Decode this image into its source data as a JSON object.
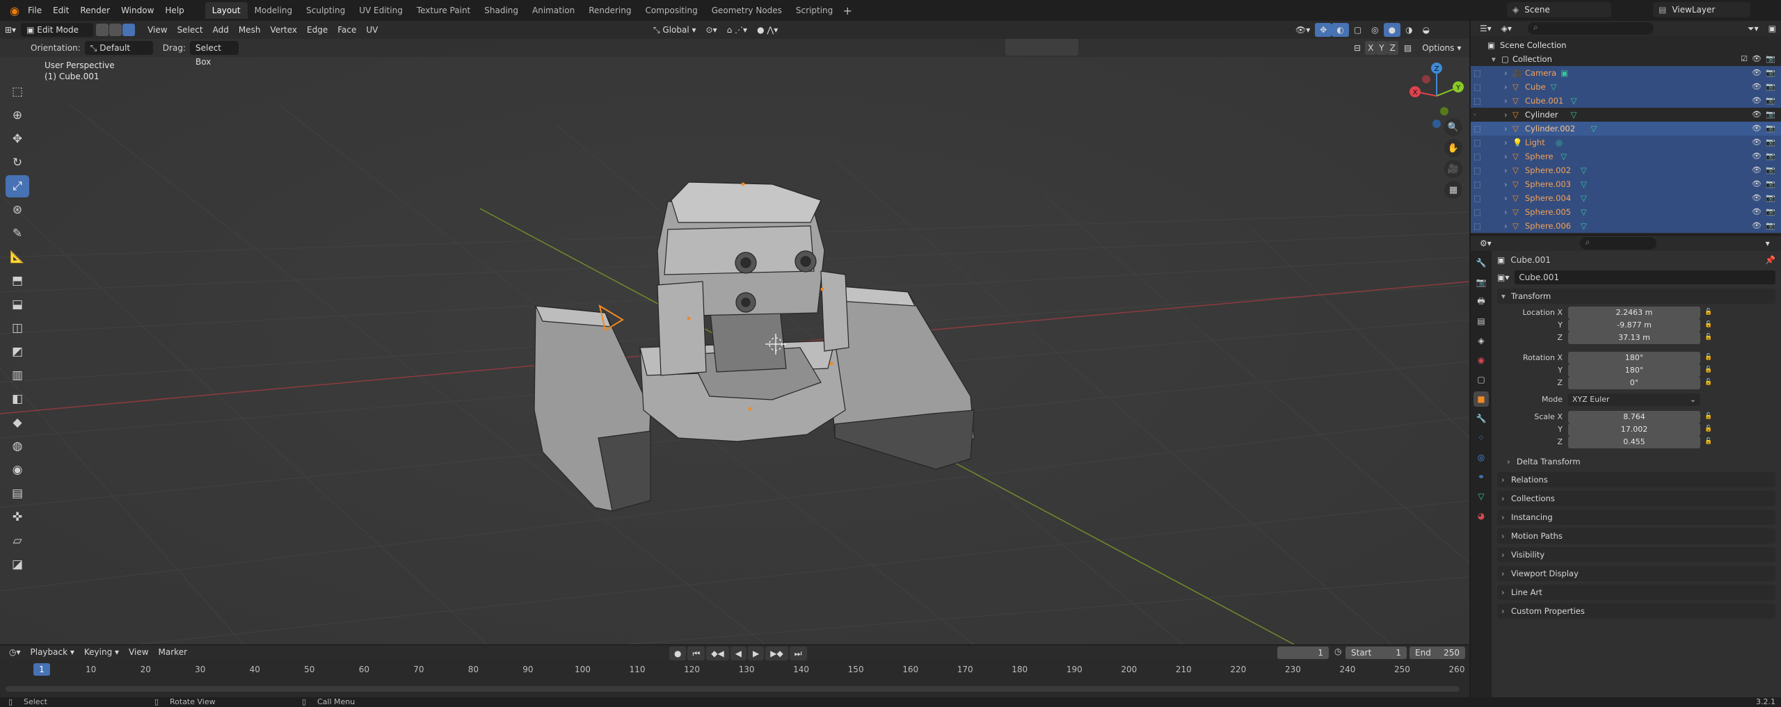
{
  "topbar": {
    "menus": [
      "File",
      "Edit",
      "Render",
      "Window",
      "Help"
    ],
    "workspaces": [
      "Layout",
      "Modeling",
      "Sculpting",
      "UV Editing",
      "Texture Paint",
      "Shading",
      "Animation",
      "Rendering",
      "Compositing",
      "Geometry Nodes",
      "Scripting"
    ],
    "active_workspace": "Layout",
    "scene": "Scene",
    "view_layer": "ViewLayer"
  },
  "viewport": {
    "mode": "Edit Mode",
    "header_menus": [
      "View",
      "Select",
      "Add",
      "Mesh",
      "Vertex",
      "Edge",
      "Face",
      "UV"
    ],
    "transform_orientation": "Global",
    "orientation_label": "Orientation:",
    "orientation_value": "Default",
    "drag_label": "Drag:",
    "drag_value": "Select Box",
    "axis_x": "X",
    "axis_y": "Y",
    "axis_z": "Z",
    "options_label": "Options",
    "view_name": "User Perspective",
    "object_label": "(1) Cube.001",
    "gizmo": {
      "x": "X",
      "y": "Y",
      "z": "Z"
    }
  },
  "toolbar": {
    "tools": [
      "select-box",
      "cursor",
      "move",
      "rotate",
      "scale",
      "transform",
      "annotate",
      "measure",
      "add-cube",
      "extrude",
      "inset",
      "bevel",
      "loop-cut",
      "knife",
      "poly-build",
      "spin",
      "smooth",
      "edge-slide",
      "shrink-fatten",
      "shear",
      "rip"
    ]
  },
  "timeline": {
    "menus": [
      "Playback",
      "Keying",
      "View",
      "Marker"
    ],
    "current_frame": "1",
    "start_label": "Start",
    "start": "1",
    "end_label": "End",
    "end": "250",
    "ruler": [
      "1",
      "10",
      "20",
      "30",
      "40",
      "50",
      "60",
      "70",
      "80",
      "90",
      "100",
      "110",
      "120",
      "130",
      "140",
      "150",
      "160",
      "170",
      "180",
      "190",
      "200",
      "210",
      "220",
      "230",
      "240",
      "250",
      "260"
    ]
  },
  "status": {
    "select": "Select",
    "rotate": "Rotate View",
    "menu": "Call Menu",
    "version": "3.2.1"
  },
  "outliner": {
    "scene_collection": "Scene Collection",
    "collection": "Collection",
    "items": [
      {
        "name": "Camera",
        "type": "camera",
        "selected": true,
        "active": false
      },
      {
        "name": "Cube",
        "type": "mesh",
        "selected": true,
        "active": false
      },
      {
        "name": "Cube.001",
        "type": "mesh",
        "selected": true,
        "active": false
      },
      {
        "name": "Cylinder",
        "type": "mesh",
        "selected": false,
        "active": false
      },
      {
        "name": "Cylinder.002",
        "type": "mesh",
        "selected": true,
        "active": true
      },
      {
        "name": "Light",
        "type": "light",
        "selected": true,
        "active": false
      },
      {
        "name": "Sphere",
        "type": "mesh",
        "selected": true,
        "active": false
      },
      {
        "name": "Sphere.002",
        "type": "mesh",
        "selected": true,
        "active": false
      },
      {
        "name": "Sphere.003",
        "type": "mesh",
        "selected": true,
        "active": false
      },
      {
        "name": "Sphere.004",
        "type": "mesh",
        "selected": true,
        "active": false
      },
      {
        "name": "Sphere.005",
        "type": "mesh",
        "selected": true,
        "active": false
      },
      {
        "name": "Sphere.006",
        "type": "mesh",
        "selected": true,
        "active": false
      }
    ]
  },
  "properties": {
    "object_name": "Cube.001",
    "data_name": "Cube.001",
    "transform_title": "Transform",
    "location_label": "Location X",
    "rotation_label": "Rotation X",
    "scale_label": "Scale X",
    "y_label": "Y",
    "z_label": "Z",
    "location": [
      "2.2463 m",
      "-9.877 m",
      "37.13 m"
    ],
    "rotation": [
      "180°",
      "180°",
      "0°"
    ],
    "mode_label": "Mode",
    "mode": "XYZ Euler",
    "scale": [
      "8.764",
      "17.002",
      "0.455"
    ],
    "delta": "Delta Transform",
    "panels": [
      "Relations",
      "Collections",
      "Instancing",
      "Motion Paths",
      "Visibility",
      "Viewport Display",
      "Line Art",
      "Custom Properties"
    ]
  },
  "colors": {
    "accent": "#4772b3",
    "selection": "#334d80",
    "object_orange": "#f3a257",
    "axis_x": "#e0424c",
    "axis_y": "#8ac926",
    "axis_z": "#3f8ad6"
  }
}
